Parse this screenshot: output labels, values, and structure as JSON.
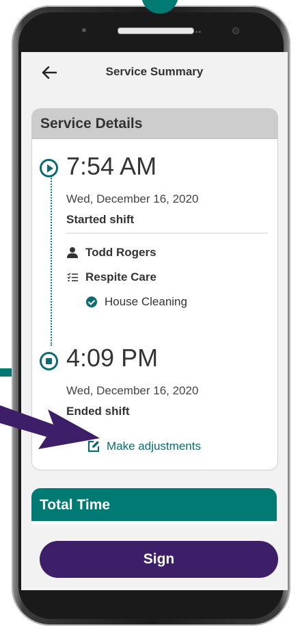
{
  "header": {
    "title": "Service Summary"
  },
  "service_details": {
    "title": "Service Details",
    "start": {
      "time": "7:54 AM",
      "date": "Wed, December 16, 2020",
      "label": "Started shift"
    },
    "caregiver": "Todd Rogers",
    "service_type": "Respite Care",
    "task": "House Cleaning",
    "end": {
      "time": "4:09 PM",
      "date": "Wed, December 16, 2020",
      "label": "Ended shift"
    },
    "adjust_label": "Make adjustments"
  },
  "total_time": {
    "title": "Total Time"
  },
  "sign_label": "Sign",
  "colors": {
    "teal": "#007a72",
    "purple": "#3d1f69",
    "header_gray": "#cccccc"
  }
}
